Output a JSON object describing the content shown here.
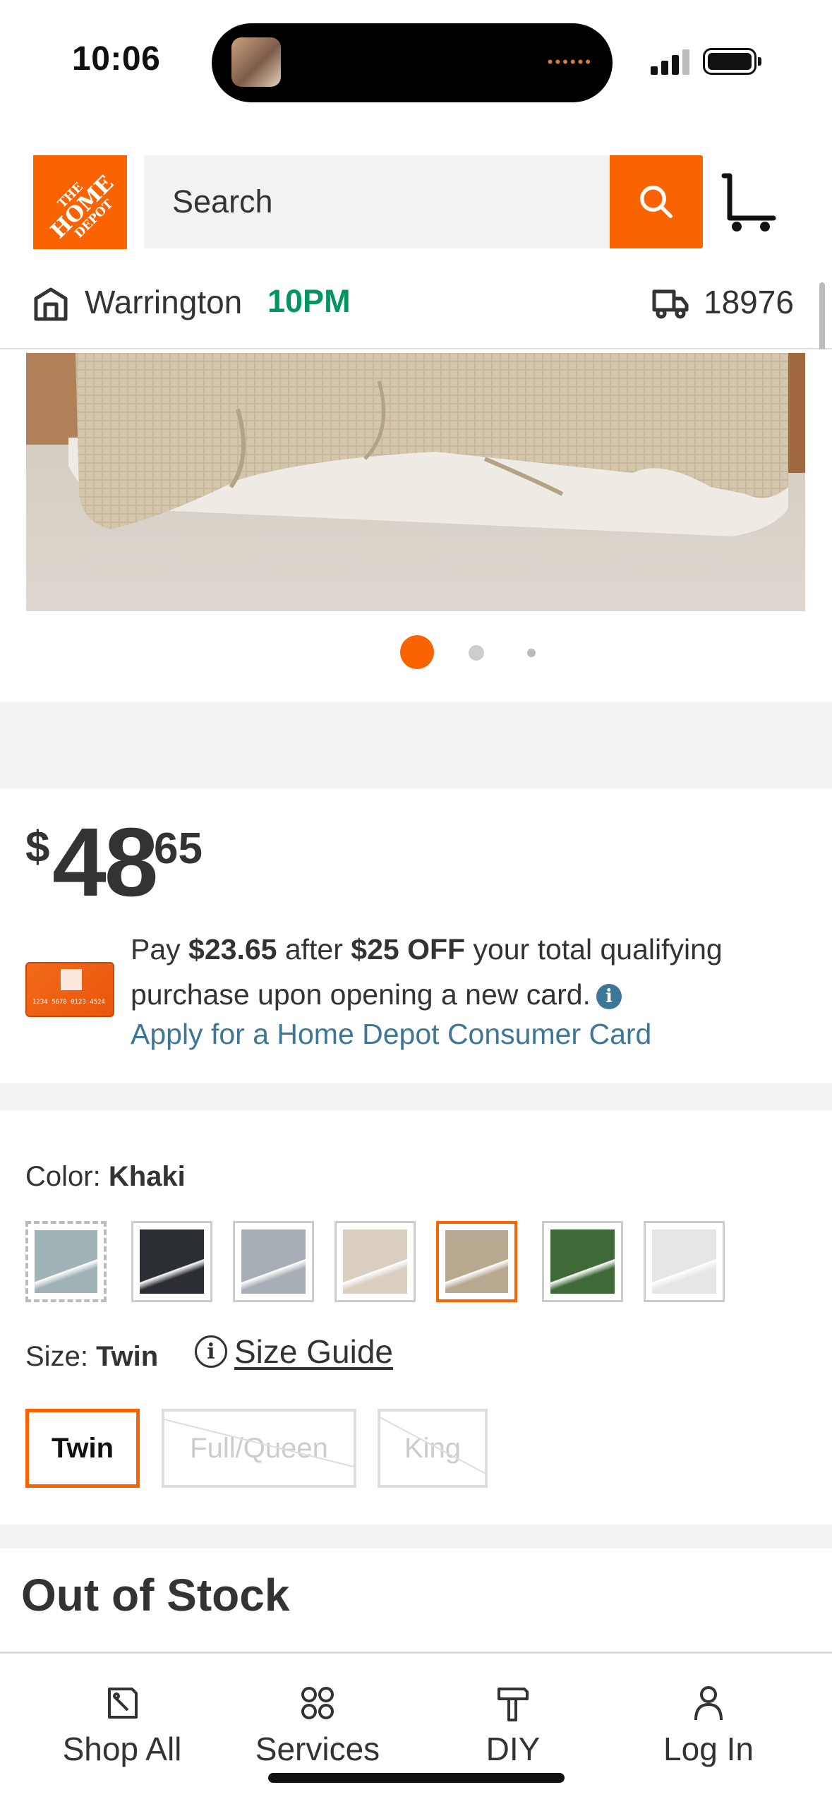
{
  "status_bar": {
    "time": "10:06"
  },
  "header": {
    "logo": {
      "line1": "THE",
      "line2": "HOME",
      "line3": "DEPOT"
    },
    "search": {
      "placeholder": "Search"
    },
    "store": {
      "name": "Warrington",
      "closes": "10PM"
    },
    "delivery": {
      "zip": "18976"
    }
  },
  "product": {
    "image_alt": "Khaki waffle blanket on bed",
    "carousel": {
      "count": 3,
      "active_index": 0
    },
    "price": {
      "currency": "$",
      "dollars": "48",
      "cents": "65"
    },
    "promo": {
      "prefix": "Pay ",
      "amount_after": "$23.65",
      "middle": " after ",
      "discount": "$25 OFF",
      "suffix": " your total qualifying purchase upon opening a new card.",
      "apply_link": "Apply for a Home Depot Consumer Card",
      "card_number": "1234 5678 0123 4524"
    },
    "color": {
      "label": "Color:",
      "selected": "Khaki",
      "swatches": [
        {
          "name": "Blue Gray",
          "color": "#9fb2b6",
          "style": "dashed"
        },
        {
          "name": "Black",
          "color": "#2b2e33",
          "style": "normal"
        },
        {
          "name": "Gray",
          "color": "#a7aeb5",
          "style": "normal"
        },
        {
          "name": "Natural",
          "color": "#d8cfc0",
          "style": "normal"
        },
        {
          "name": "Khaki",
          "color": "#b8a88f",
          "style": "selected"
        },
        {
          "name": "Green",
          "color": "#3f6a37",
          "style": "normal"
        },
        {
          "name": "White",
          "color": "#e6e6e8",
          "style": "normal"
        }
      ]
    },
    "size": {
      "label": "Size:",
      "selected": "Twin",
      "guide": "Size Guide",
      "options": [
        {
          "label": "Twin",
          "state": "selected"
        },
        {
          "label": "Full/Queen",
          "state": "disabled"
        },
        {
          "label": "King",
          "state": "disabled"
        }
      ]
    },
    "stock_status": "Out of Stock"
  },
  "bottom_nav": {
    "items": [
      {
        "label": "Shop All",
        "icon": "tag-icon"
      },
      {
        "label": "Services",
        "icon": "grid-dots-icon"
      },
      {
        "label": "DIY",
        "icon": "hammer-icon"
      },
      {
        "label": "Log In",
        "icon": "user-icon"
      }
    ]
  },
  "colors": {
    "brand_orange": "#f96302",
    "open_green": "#00965e",
    "link_blue": "#3e7697"
  }
}
